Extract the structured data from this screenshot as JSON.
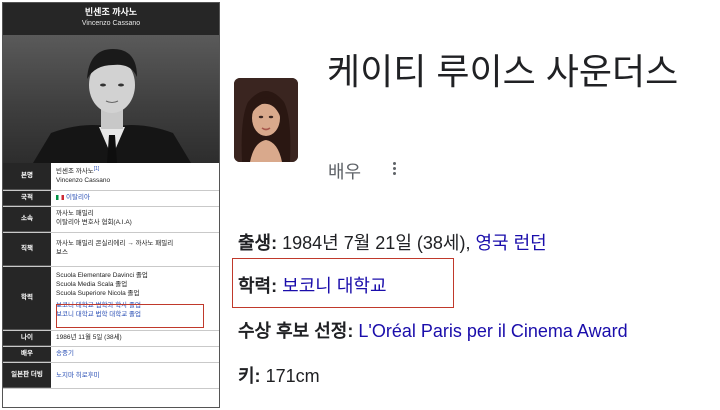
{
  "infobox": {
    "header_name": "빈센조 까사노",
    "header_name_en": "Vincenzo Cassano",
    "rows": [
      {
        "label": "본명",
        "lines": [
          {
            "text": "빈센조 까사노",
            "link": false,
            "sup": "[1]"
          },
          {
            "text": "Vincenzo Cassano",
            "link": false
          }
        ]
      },
      {
        "label": "국적",
        "lines": [
          {
            "text": "이탈리아",
            "link": true,
            "flag": true
          }
        ]
      },
      {
        "label": "소속",
        "lines": [
          {
            "text": "까사노 패밀리",
            "link": false
          },
          {
            "text": "이탈리아 변호사 협회(A.I.A)",
            "link": false
          }
        ]
      },
      {
        "label": "직책",
        "lines": [
          {
            "text": "까사노 패밀리 콘실리에리 → 까사노 패밀리",
            "link": false
          },
          {
            "text": "보스",
            "link": false
          }
        ]
      },
      {
        "label": "학력",
        "lines": [
          {
            "text": "Scuola Elementare Davinci 졸업",
            "link": false
          },
          {
            "text": "Scuola Media Scala 졸업",
            "link": false
          },
          {
            "text": "Scuola Superiore Nicola 졸업",
            "link": false
          },
          {
            "text": "보코니 대학교 법학과 학사 졸업",
            "link": true
          },
          {
            "text": "보코니 대학교 법학 대학교 졸업",
            "link": true
          }
        ]
      },
      {
        "label": "나이",
        "lines": [
          {
            "text": "1986년 11월 5일 (38세)",
            "link": false
          }
        ]
      },
      {
        "label": "배우",
        "lines": [
          {
            "text": "송중기",
            "link": true
          }
        ]
      },
      {
        "label": "일본판 더빙",
        "lines": [
          {
            "text": "노지마 히로후미",
            "link": true
          }
        ]
      }
    ]
  },
  "panel": {
    "title": "케이티 루이스 사운더스",
    "subtitle": "배우",
    "facts": [
      {
        "key": "출생:",
        "value": " 1984년 7월 21일 (38세), ",
        "link": "영국 런던"
      },
      {
        "key": "학력:",
        "value": " ",
        "link": "보코니 대학교"
      },
      {
        "key": "수상 후보 선정:",
        "value": " ",
        "link": "L'Oréal Paris per il Cinema Award"
      },
      {
        "key": "키:",
        "value": " 171cm",
        "link": ""
      }
    ]
  },
  "colors": {
    "infobox_header": "#262626",
    "link_blue": "#1a0dab",
    "highlight_red": "#c0392b"
  }
}
